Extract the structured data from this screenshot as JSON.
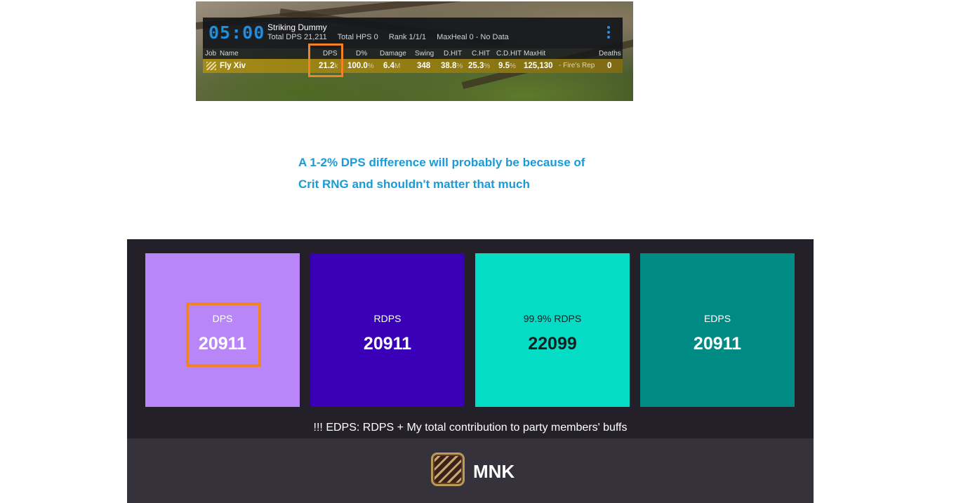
{
  "overlay": {
    "timer": "05:00",
    "encounter": "Striking Dummy",
    "stats": [
      "Total DPS 21,211",
      "Total HPS 0",
      "Rank 1/1/1",
      "MaxHeal 0 - No Data"
    ],
    "columns": [
      "Job",
      "Name",
      "DPS",
      "D%",
      "Damage",
      "Swing",
      "D.HIT",
      "C.HIT",
      "C.D.HIT",
      "MaxHit",
      "Deaths"
    ],
    "row": {
      "name": "Fly Xiv",
      "dps": "21.2",
      "dps_unit": "k",
      "dpct": "100.0",
      "dpct_unit": "%",
      "damage": "6.4",
      "damage_unit": "M",
      "swing": "348",
      "dhit": "38.8",
      "dhit_unit": "%",
      "chit": "25.3",
      "chit_unit": "%",
      "cdhit": "9.5",
      "cdhit_unit": "%",
      "maxhit": "125,130",
      "maxhit_skill": "- Fire's Rep",
      "deaths": "0"
    }
  },
  "note": {
    "line1": "A 1-2% DPS difference will probably be because of",
    "line2": "Crit RNG and shouldn't matter that much"
  },
  "panel": {
    "cards": [
      {
        "label": "DPS",
        "value": "20911"
      },
      {
        "label": "RDPS",
        "value": "20911"
      },
      {
        "label": "99.9% RDPS",
        "value": "22099"
      },
      {
        "label": "EDPS",
        "value": "20911"
      }
    ],
    "footnote": "!!! EDPS: RDPS + My total contribution to party members' buffs",
    "job": "MNK"
  },
  "colors": {
    "highlight": "#f08325",
    "dps_card": "#b886f7",
    "rdps_card": "#3900b8",
    "rdps99_card": "#04dcc6",
    "edps_card": "#008a84",
    "note_text": "#1a9ad6",
    "panel_bg": "#23202a",
    "timer": "#1d8fe0"
  }
}
